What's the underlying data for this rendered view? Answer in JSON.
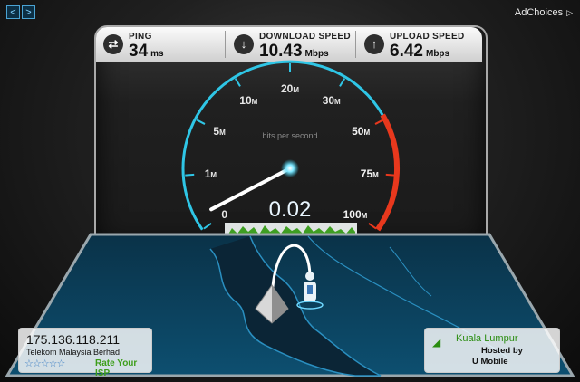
{
  "nav": {
    "back_glyph": "<",
    "forward_glyph": ">"
  },
  "ad": {
    "label": "AdChoices",
    "icon": "adchoices-triangle-icon"
  },
  "stats": {
    "ping": {
      "label": "PING",
      "value": "34",
      "unit": "ms",
      "icon": "ping-icon"
    },
    "download": {
      "label": "DOWNLOAD SPEED",
      "value": "10.43",
      "unit": "Mbps",
      "icon": "download-arrow-icon"
    },
    "upload": {
      "label": "UPLOAD SPEED",
      "value": "6.42",
      "unit": "Mbps",
      "icon": "upload-arrow-icon"
    }
  },
  "gauge": {
    "caption": "bits per second",
    "current_value": "0.02",
    "needle_fraction": 0.03,
    "ticks": [
      {
        "num": "0",
        "unit": ""
      },
      {
        "num": "1",
        "unit": "M"
      },
      {
        "num": "5",
        "unit": "M"
      },
      {
        "num": "10",
        "unit": "M"
      },
      {
        "num": "20",
        "unit": "M"
      },
      {
        "num": "30",
        "unit": "M"
      },
      {
        "num": "50",
        "unit": "M"
      },
      {
        "num": "75",
        "unit": "M"
      },
      {
        "num": "100",
        "unit": "M"
      }
    ],
    "accent_color": "#2fc6e6",
    "redzone_color": "#e8381d"
  },
  "client": {
    "ip": "175.136.118.211",
    "isp": "Telekom Malaysia Berhad",
    "stars": "☆☆☆☆☆",
    "rate_label": "Rate Your ISP"
  },
  "server": {
    "city": "Kuala Lumpur",
    "hosted_by": "Hosted by",
    "sponsor": "U Mobile"
  }
}
